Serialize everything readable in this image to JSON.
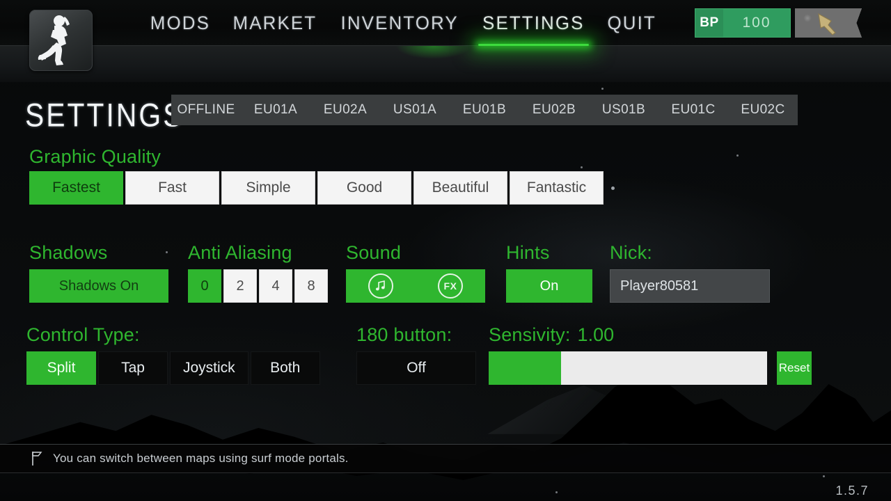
{
  "app": {
    "version_label": "1.5.7",
    "accent_green": "#2fb62f",
    "nav_underline_green": "#3ddb3d",
    "logo_icon": "running-player-silhouette-icon"
  },
  "header": {
    "nav": [
      {
        "label": "MODS",
        "active": false
      },
      {
        "label": "MARKET",
        "active": false
      },
      {
        "label": "INVENTORY",
        "active": false
      },
      {
        "label": "SETTINGS",
        "active": true
      },
      {
        "label": "QUIT",
        "active": false
      }
    ],
    "currency": {
      "code": "BP",
      "amount": "100",
      "item_icon": "knife-icon"
    }
  },
  "page": {
    "title": "SETTINGS"
  },
  "servers": {
    "tabs": [
      "OFFLINE",
      "EU01A",
      "EU02A",
      "US01A",
      "EU01B",
      "EU02B",
      "US01B",
      "EU01C",
      "EU02C"
    ],
    "selected": "OFFLINE"
  },
  "graphic_quality": {
    "label": "Graphic Quality",
    "options": [
      "Fastest",
      "Fast",
      "Simple",
      "Good",
      "Beautiful",
      "Fantastic"
    ],
    "selected": "Fastest"
  },
  "shadows": {
    "label": "Shadows",
    "value": "Shadows On",
    "enabled": true
  },
  "anti_aliasing": {
    "label": "Anti Aliasing",
    "options": [
      "0",
      "2",
      "4",
      "8"
    ],
    "selected": "0"
  },
  "sound": {
    "label": "Sound",
    "music_icon": "music-note-icon",
    "fx_icon": "fx-icon",
    "fx_label": "FX",
    "music_on": true,
    "fx_on": true
  },
  "hints": {
    "label": "Hints",
    "value": "On",
    "enabled": true
  },
  "nick": {
    "label": "Nick:",
    "value": "Player80581",
    "placeholder": "Nick"
  },
  "control_type": {
    "label": "Control Type:",
    "options": [
      "Split",
      "Tap",
      "Joystick",
      "Both"
    ],
    "selected": "Split"
  },
  "button_180": {
    "label": "180 button:",
    "value": "Off",
    "enabled": false
  },
  "sensitivity": {
    "label": "Sensivity:",
    "value": "1.00",
    "fill_percent": 26,
    "reset_label": "Reset"
  },
  "hint_bar": {
    "icon": "flag-icon",
    "text": "You can switch between maps using surf mode portals."
  }
}
